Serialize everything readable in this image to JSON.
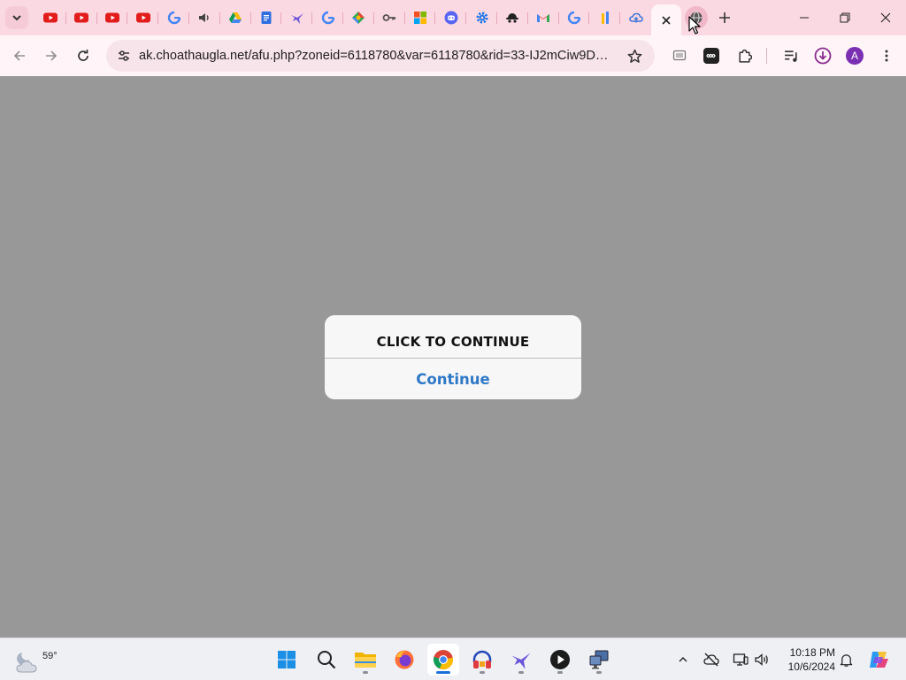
{
  "browser": {
    "tabs": [
      {
        "icon": "youtube-icon"
      },
      {
        "icon": "youtube-icon"
      },
      {
        "icon": "youtube-icon"
      },
      {
        "icon": "youtube-icon"
      },
      {
        "icon": "google-icon"
      },
      {
        "icon": "speaker-icon"
      },
      {
        "icon": "google-drive-icon"
      },
      {
        "icon": "google-docs-icon"
      },
      {
        "icon": "bird-icon"
      },
      {
        "icon": "google-icon"
      },
      {
        "icon": "colorful-diamond-icon"
      },
      {
        "icon": "key-icon"
      },
      {
        "icon": "microsoft-icon"
      },
      {
        "icon": "discord-icon"
      },
      {
        "icon": "gear-icon"
      },
      {
        "icon": "incognito-hat-icon"
      },
      {
        "icon": "gmail-icon"
      },
      {
        "icon": "google-icon"
      },
      {
        "icon": "bars-icon"
      },
      {
        "icon": "cloud-icon"
      },
      {
        "icon": "close-icon",
        "active": true
      },
      {
        "icon": "globe-icon",
        "hover": true
      }
    ],
    "address_bar": {
      "url": "ak.choathaugla.net/afu.php?zoneid=6118780&var=6118780&rid=33-IJ2mCiw9DGbm..."
    },
    "profile_initial": "A"
  },
  "dialog": {
    "title": "CLICK TO CONTINUE",
    "button_label": "Continue"
  },
  "taskbar": {
    "weather_temp": "59°",
    "clock_time": "10:18 PM",
    "clock_date": "10/6/2024"
  },
  "colors": {
    "page_background": "#989898",
    "tab_strip": "#fbd9e3",
    "dialog_button_text": "#2e78c7"
  }
}
